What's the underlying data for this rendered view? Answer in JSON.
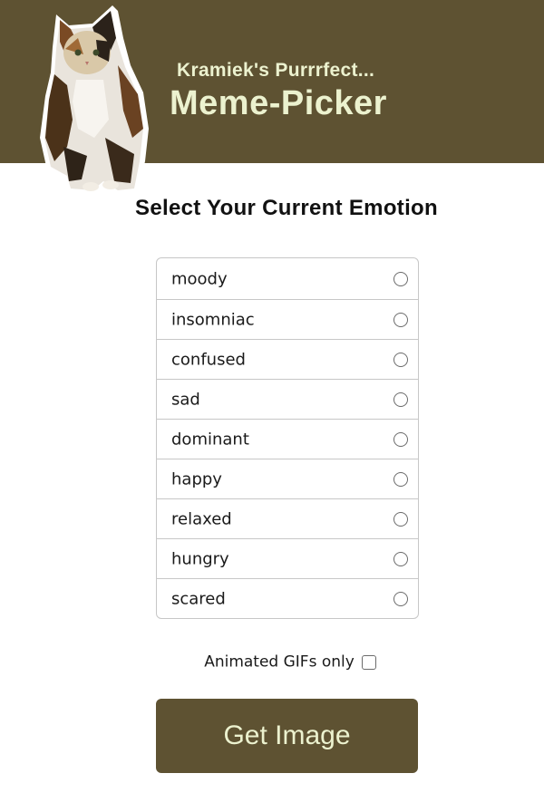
{
  "header": {
    "subtitle": "Kramiek's Purrrfect...",
    "title": "Meme-Picker",
    "background_color": "#5e5232",
    "text_color": "#ecf2cf"
  },
  "main": {
    "heading": "Select Your Current Emotion",
    "emotions": [
      {
        "label": "moody",
        "selected": false
      },
      {
        "label": "insomniac",
        "selected": false
      },
      {
        "label": "confused",
        "selected": false
      },
      {
        "label": "sad",
        "selected": false
      },
      {
        "label": "dominant",
        "selected": false
      },
      {
        "label": "happy",
        "selected": false
      },
      {
        "label": "relaxed",
        "selected": false
      },
      {
        "label": "hungry",
        "selected": false
      },
      {
        "label": "scared",
        "selected": false
      }
    ],
    "gif_option": {
      "label": "Animated GIFs only",
      "checked": false
    },
    "button_label": "Get Image"
  }
}
